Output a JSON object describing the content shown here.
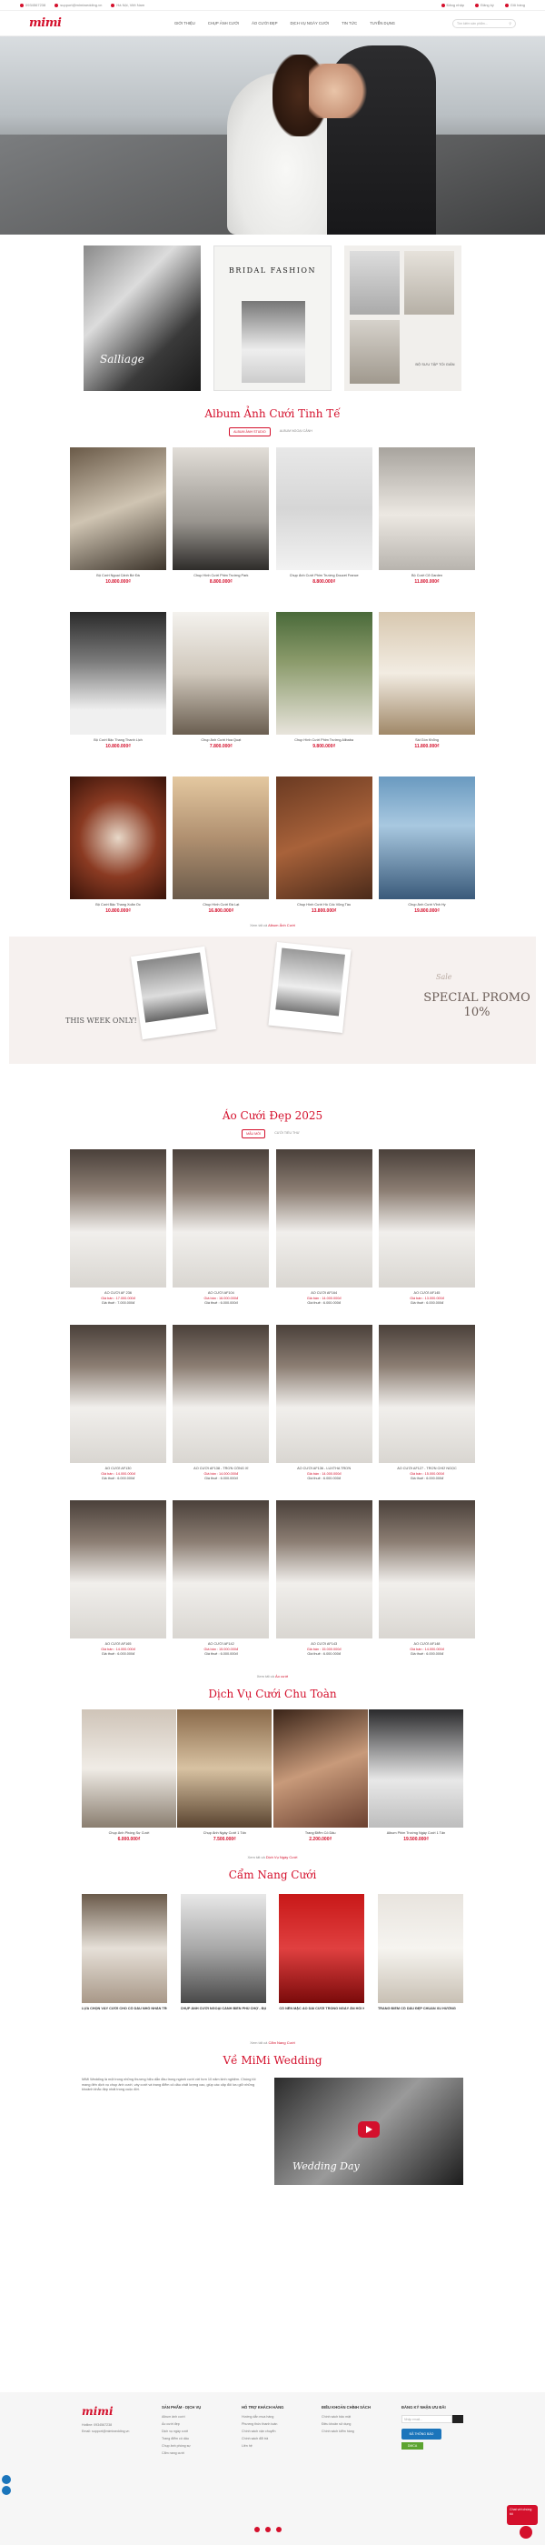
{
  "topbar": {
    "phone": "0934567238",
    "email": "support@mimiwedding.vn",
    "address": "Hà Nội, Việt Nam",
    "login": "Đăng nhập",
    "register": "Đăng ký",
    "cart": "Giỏ hàng"
  },
  "header": {
    "logo": "mimi",
    "nav": [
      "Giới thiệu",
      "Chụp ảnh cưới",
      "Áo cưới đẹp",
      "Dịch vụ ngày cưới",
      "Tin tức",
      "Tuyển dụng"
    ],
    "search_placeholder": "Tìm kiếm sản phẩm..."
  },
  "features": {
    "signature": "Salliage",
    "bridal_title": "BRIDAL FASHION",
    "caption": "BỘ SƯU TẬP TỐI GIẢN"
  },
  "album": {
    "title": "Album Ảnh Cưới Tinh Tế",
    "tabs": [
      "Album ảnh studio",
      "Album ngoại cảnh"
    ],
    "items": [
      {
        "name": "Bộ Cưới Ngoại Cảnh Bờ Đá",
        "price": "10.800.000₫"
      },
      {
        "name": "Chụp Hình Cưới Phim Trường Park",
        "price": "8.800.000₫"
      },
      {
        "name": "Chụp Ảnh Cưới Phim Trường Doucet France",
        "price": "8.800.000₫"
      },
      {
        "name": "Bộ Cưới Cổ Garden",
        "price": "11.800.000₫"
      },
      {
        "name": "Bộ Cưới Bậc Thang Thanh Lịch",
        "price": "10.800.000₫"
      },
      {
        "name": "Chụp Ảnh Cưới Hoa Quạt",
        "price": "7.800.000₫"
      },
      {
        "name": "Chụp Hình Cưới Phim Trường Alibaba",
        "price": "9.800.000₫"
      },
      {
        "name": "Sài Gòn Khổng",
        "price": "11.800.000₫"
      },
      {
        "name": "Bộ Cưới Bậc Thang Xoắn Ốc",
        "price": "10.800.000₫"
      },
      {
        "name": "Chụp Hình Cưới Đà Lạt",
        "price": "16.800.000₫"
      },
      {
        "name": "Chụp Hình Cưới Hồ Cốc Vũng Tàu",
        "price": "13.800.000₫"
      },
      {
        "name": "Chụp Ảnh Cưới Vĩnh Hy",
        "price": "19.800.000₫"
      }
    ],
    "see_all_prefix": "Xem tất cả",
    "see_all_link": "Album Ảnh Cưới"
  },
  "promo": {
    "week": "THIS WEEK ONLY!",
    "sale": "Sale",
    "special": "SPECIAL PROMO 10%"
  },
  "dresses": {
    "title": "Áo Cưới Đẹp 2025",
    "tabs": [
      "Mẫu mới",
      "Cưới tiểu thư"
    ],
    "items": [
      {
        "name": "ÁO CƯỚI AF 236",
        "sale": "Giá bán : 17.000.000đ",
        "rent": "Giá thuê : 7.000.000đ"
      },
      {
        "name": "ÁO CƯỚI AF104",
        "sale": "Giá bán : 16.000.000đ",
        "rent": "Giá thuê : 6.000.000đ"
      },
      {
        "name": "ÁO CƯỚI AF164",
        "sale": "Giá bán : 14.000.000đ",
        "rent": "Giá thuê : 6.000.000đ"
      },
      {
        "name": "ÁO CƯỚI AF145",
        "sale": "Giá bán : 13.000.000đ",
        "rent": "Giá thuê : 6.000.000đ"
      },
      {
        "name": "ÁO CƯỚI AF130",
        "sale": "Giá bán : 14.000.000đ",
        "rent": "Giá thuê : 6.000.000đ"
      },
      {
        "name": "ÁO CƯỚI AF138 - TRƠN CÔNG XỈ",
        "sale": "Giá bán : 14.000.000đ",
        "rent": "Giá thuê : 6.000.000đ"
      },
      {
        "name": "ÁO CƯỚI AF136 - LUXTHA TRƠN",
        "sale": "Giá bán : 14.000.000đ",
        "rent": "Giá thuê : 6.000.000đ"
      },
      {
        "name": "ÁO CƯỚI AF127 - TRƠN CHỮ NGỌC",
        "sale": "Giá bán : 15.000.000đ",
        "rent": "Giá thuê : 6.000.000đ"
      },
      {
        "name": "ÁO CƯỚI AF165",
        "sale": "Giá bán : 14.000.000đ",
        "rent": "Giá thuê : 6.000.000đ"
      },
      {
        "name": "ÁO CƯỚI AF142",
        "sale": "Giá bán : 15.000.000đ",
        "rent": "Giá thuê : 6.000.000đ"
      },
      {
        "name": "ÁO CƯỚI AF143",
        "sale": "Giá bán : 15.000.000đ",
        "rent": "Giá thuê : 6.000.000đ"
      },
      {
        "name": "ÁO CƯỚI AF148",
        "sale": "Giá bán : 14.000.000đ",
        "rent": "Giá thuê : 6.000.000đ"
      }
    ],
    "see_all_prefix": "Xem tất cả",
    "see_all_link": "Áo cưới"
  },
  "services": {
    "title": "Dịch Vụ Cưới Chu Toàn",
    "items": [
      {
        "name": "Chụp Ảnh Phóng Sự Cưới",
        "price": "6.000.000₫"
      },
      {
        "name": "Chụp Ảnh Ngày Cưới 1 Tấn",
        "price": "7.500.000₫"
      },
      {
        "name": "Trang Điểm Cô Dâu",
        "price": "2.200.000₫"
      },
      {
        "name": "Album Phim Trường Ngày Cưới 1 Tấn",
        "price": "19.500.000₫"
      }
    ],
    "see_all_prefix": "Xem tất cả",
    "see_all_link": "Dịch Vụ Ngày Cưới"
  },
  "news": {
    "title": "Cẩm Nang Cưới",
    "items": [
      {
        "name": "LỰA CHỌN VÁY CƯỚI CHO CÔ DÂU NHỎ NHẮN TRONG NGÀY CƯỚI"
      },
      {
        "name": "CHỤP ẢNH CƯỚI NGOẠI CẢNH BIỂN PHỦ CHỢ - ĐỊA ĐIỂM LÝ TƯỞNG"
      },
      {
        "name": "CÓ NÊN MẶC ÁO DÀI CƯỚI TRONG NGÀY ĂN HỎI KHÔNG"
      },
      {
        "name": "TRANG ĐIỂM CÔ DÂU ĐẸP CHUẨN XU HƯỚNG"
      }
    ],
    "see_all_prefix": "Xem tất cả",
    "see_all_link": "Cẩm Nang Cưới"
  },
  "about": {
    "title": "Về MiMi Wedding",
    "text": "MiMi Wedding là một trong những thương hiệu dẫn đầu trong ngành cưới với hơn 10 năm kinh nghiệm. Chúng tôi mang đến dịch vụ chụp ảnh cưới, váy cưới và trang điểm cô dâu chất lượng cao, giúp các cặp đôi lưu giữ những khoảnh khắc đẹp nhất trong cuộc đời.",
    "video_title": "Wedding Day"
  },
  "footer": {
    "logo": "mimi",
    "phone": "Hotline: 0934567238",
    "email": "Email: support@mimiwedding.vn",
    "col1_title": "Sản phẩm - Dịch vụ",
    "col1": [
      "Album ảnh cưới",
      "Áo cưới đẹp",
      "Dịch vụ ngày cưới",
      "Trang điểm cô dâu",
      "Chụp ảnh phóng sự",
      "Cẩm nang cưới"
    ],
    "col2_title": "Hỗ trợ khách hàng",
    "col2": [
      "Hướng dẫn mua hàng",
      "Phương thức thanh toán",
      "Chính sách vận chuyển",
      "Chính sách đổi trả",
      "Liên hệ"
    ],
    "col3_title": "Điều khoản chính sách",
    "col3": [
      "Chính sách bảo mật",
      "Điều khoản sử dụng",
      "Chính sách kiểm hàng"
    ],
    "col4_title": "Đăng ký nhận ưu đãi",
    "email_placeholder": "Nhập email...",
    "badge": "ĐÃ THÔNG BÁO",
    "dmca": "DMCA"
  },
  "chat": {
    "label": "Chat với chúng tôi"
  }
}
